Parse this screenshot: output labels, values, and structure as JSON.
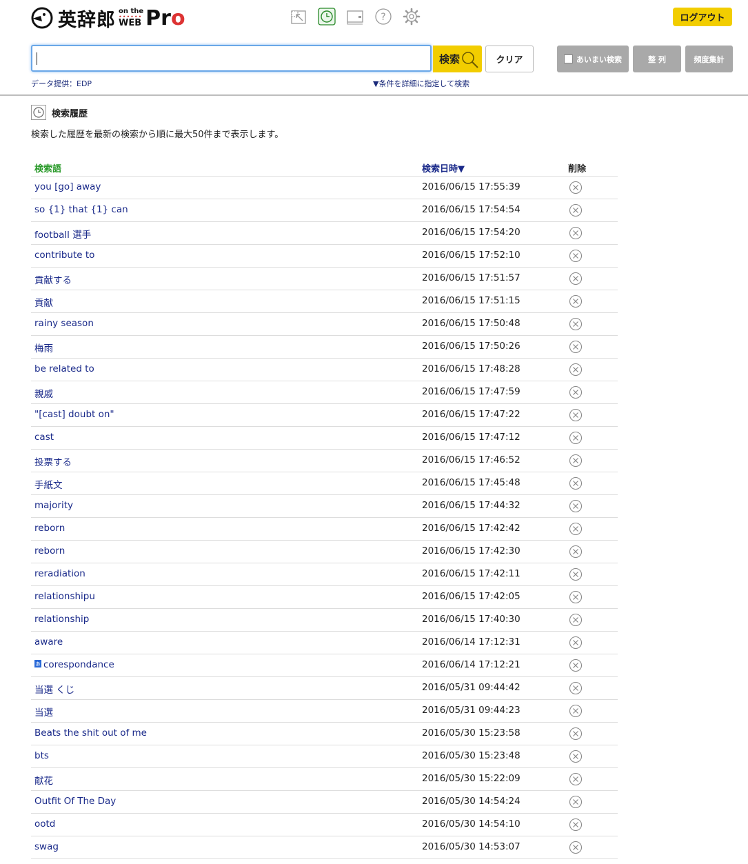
{
  "logo": {
    "word": "英辞郎",
    "on_the": "on the",
    "web": "WEB",
    "pro_p": "P",
    "pro_r": "r",
    "pro_o": "o"
  },
  "toolbar_icons": [
    "pop-out-icon",
    "history-icon",
    "display-settings-icon",
    "help-icon",
    "gear-icon"
  ],
  "header": {
    "logout_label": "ログアウト"
  },
  "search": {
    "value": "",
    "placeholder": "",
    "button_label": "検索",
    "clear_label": "クリア",
    "fuzzy_label": "あいまい検索",
    "sort_label": "整 列",
    "frequency_label": "頻度集計",
    "data_provider": "データ提供：EDP",
    "advanced_link": "▼条件を詳細に指定して検索"
  },
  "history": {
    "title": "検索履歴",
    "description": "検索した履歴を最新の検索から順に最大50件まで表示します。",
    "col_word": "検索語",
    "col_date": "検索日時▼",
    "col_delete": "削除",
    "rows": [
      {
        "word": "you [go] away",
        "date": "2016/06/15 17:55:39"
      },
      {
        "word": "so {1} that {1} can",
        "date": "2016/06/15 17:54:54"
      },
      {
        "word": "football 選手",
        "date": "2016/06/15 17:54:20"
      },
      {
        "word": "contribute to",
        "date": "2016/06/15 17:52:10"
      },
      {
        "word": "貢献する",
        "date": "2016/06/15 17:51:57"
      },
      {
        "word": "貢献",
        "date": "2016/06/15 17:51:15"
      },
      {
        "word": "rainy season",
        "date": "2016/06/15 17:50:48"
      },
      {
        "word": "梅雨",
        "date": "2016/06/15 17:50:26"
      },
      {
        "word": "be related to",
        "date": "2016/06/15 17:48:28"
      },
      {
        "word": "親戚",
        "date": "2016/06/15 17:47:59"
      },
      {
        "word": "\"[cast] doubt on\"",
        "date": "2016/06/15 17:47:22"
      },
      {
        "word": "cast",
        "date": "2016/06/15 17:47:12"
      },
      {
        "word": "投票する",
        "date": "2016/06/15 17:46:52"
      },
      {
        "word": "手紙文",
        "date": "2016/06/15 17:45:48"
      },
      {
        "word": "majority",
        "date": "2016/06/15 17:44:32"
      },
      {
        "word": "reborn",
        "date": "2016/06/15 17:42:42"
      },
      {
        "word": "reborn",
        "date": "2016/06/15 17:42:30"
      },
      {
        "word": "reradiation",
        "date": "2016/06/15 17:42:11"
      },
      {
        "word": "relationshipu",
        "date": "2016/06/15 17:42:05"
      },
      {
        "word": "relationship",
        "date": "2016/06/15 17:40:30"
      },
      {
        "word": "aware",
        "date": "2016/06/14 17:12:31"
      },
      {
        "word": "corespondance",
        "date": "2016/06/14 17:12:21",
        "flag": "あ"
      },
      {
        "word": "当選 くじ",
        "date": "2016/05/31 09:44:42"
      },
      {
        "word": "当選",
        "date": "2016/05/31 09:44:23"
      },
      {
        "word": "Beats the shit out of me",
        "date": "2016/05/30 15:23:58"
      },
      {
        "word": "bts",
        "date": "2016/05/30 15:23:48"
      },
      {
        "word": "献花",
        "date": "2016/05/30 15:22:09"
      },
      {
        "word": "Outfit Of The Day",
        "date": "2016/05/30 14:54:24"
      },
      {
        "word": "ootd",
        "date": "2016/05/30 14:54:10"
      },
      {
        "word": "swag",
        "date": "2016/05/30 14:53:07"
      }
    ]
  },
  "colors": {
    "accent": "#f2cd00",
    "link": "#1a2a8a",
    "header_green": "#2a9a2a",
    "history_icon": "#2a8a2a"
  }
}
